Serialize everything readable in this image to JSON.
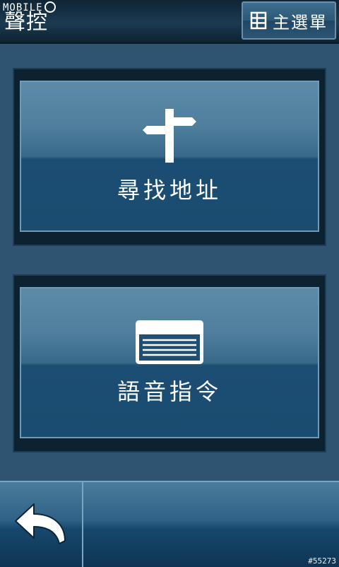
{
  "header": {
    "watermark": "MOBILE",
    "title": "聲控",
    "main_menu_label": "主選單"
  },
  "buttons": {
    "find_address": "尋找地址",
    "voice_command": "語音指令"
  },
  "footer": {
    "image_id": "#55273"
  },
  "icons": {
    "main_menu": "grid-menu-icon",
    "find_address": "signpost-icon",
    "voice_command": "command-card-icon",
    "back": "back-arrow-icon"
  },
  "colors": {
    "background": "#2e5471",
    "header": "#13293a",
    "button_top": "#5d8ba7",
    "button_bottom": "#1a4b70",
    "accent_border": "#6d9ab8"
  }
}
